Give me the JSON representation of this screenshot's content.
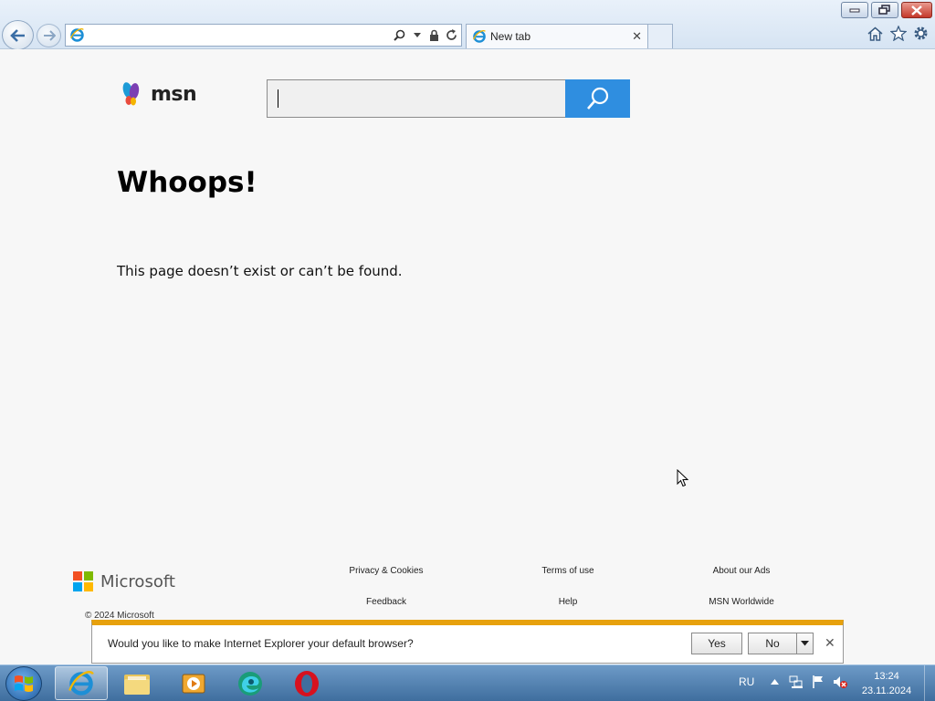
{
  "browser": {
    "address_value": "",
    "tab_title": "New tab"
  },
  "msn": {
    "logo_text": "msn",
    "search_value": ""
  },
  "error": {
    "heading": "Whoops!",
    "message": "This page doesn’t exist or can’t be found."
  },
  "footer": {
    "brand": "Microsoft",
    "copyright": "© 2024 Microsoft",
    "links": {
      "privacy": "Privacy & Cookies",
      "terms": "Terms of use",
      "about_ads": "About our Ads",
      "feedback": "Feedback",
      "help": "Help",
      "worldwide": "MSN Worldwide"
    }
  },
  "notification": {
    "text": "Would you like to make Internet Explorer your default browser?",
    "yes_label": "Yes",
    "no_label": "No"
  },
  "taskbar": {
    "language": "RU",
    "time": "13:24",
    "date": "23.11.2024"
  },
  "colors": {
    "search_button": "#2f8ee0",
    "notification_accent": "#e7a10d",
    "opera_red": "#d7111e"
  },
  "icons": [
    "back-arrow-icon",
    "forward-arrow-icon",
    "ie-icon",
    "search-icon",
    "dropdown-icon",
    "lock-icon",
    "refresh-icon",
    "close-icon",
    "home-icon",
    "star-icon",
    "gear-icon",
    "minimize-icon",
    "restore-icon",
    "msn-butterfly-icon",
    "microsoft-logo-icon",
    "windows-start-icon",
    "folder-icon",
    "media-player-icon",
    "edge-icon",
    "opera-icon",
    "flag-icon",
    "network-icon",
    "volume-muted-icon",
    "show-hidden-icons-icon",
    "mouse-cursor-icon"
  ]
}
